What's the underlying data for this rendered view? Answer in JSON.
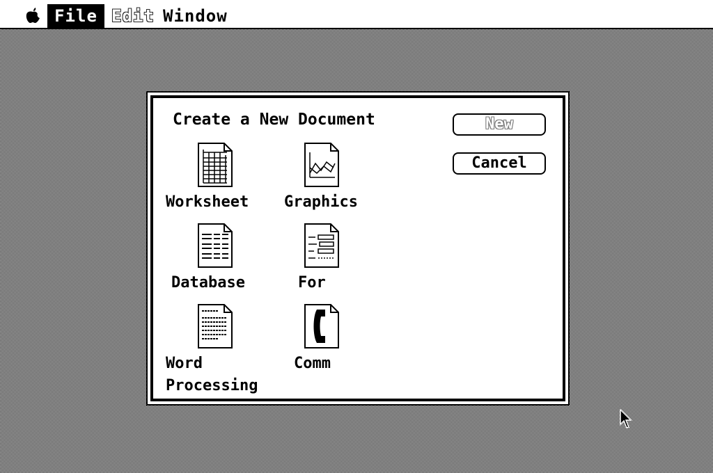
{
  "menubar": {
    "apple_icon": "apple-icon",
    "file": "File",
    "edit": "Edit",
    "window": "Window"
  },
  "dialog": {
    "title": "Create a New Document",
    "new_button": "New",
    "cancel_button": "Cancel",
    "items": [
      {
        "label": "Worksheet",
        "icon": "worksheet-icon"
      },
      {
        "label": "Graphics",
        "icon": "graphics-icon"
      },
      {
        "label": "Database",
        "icon": "database-icon"
      },
      {
        "label": "For",
        "icon": "form-icon"
      },
      {
        "label_line1": "Word",
        "label_line2": "Processing",
        "icon": "word-processing-icon"
      },
      {
        "label": "Comm",
        "icon": "communication-icon"
      }
    ]
  }
}
